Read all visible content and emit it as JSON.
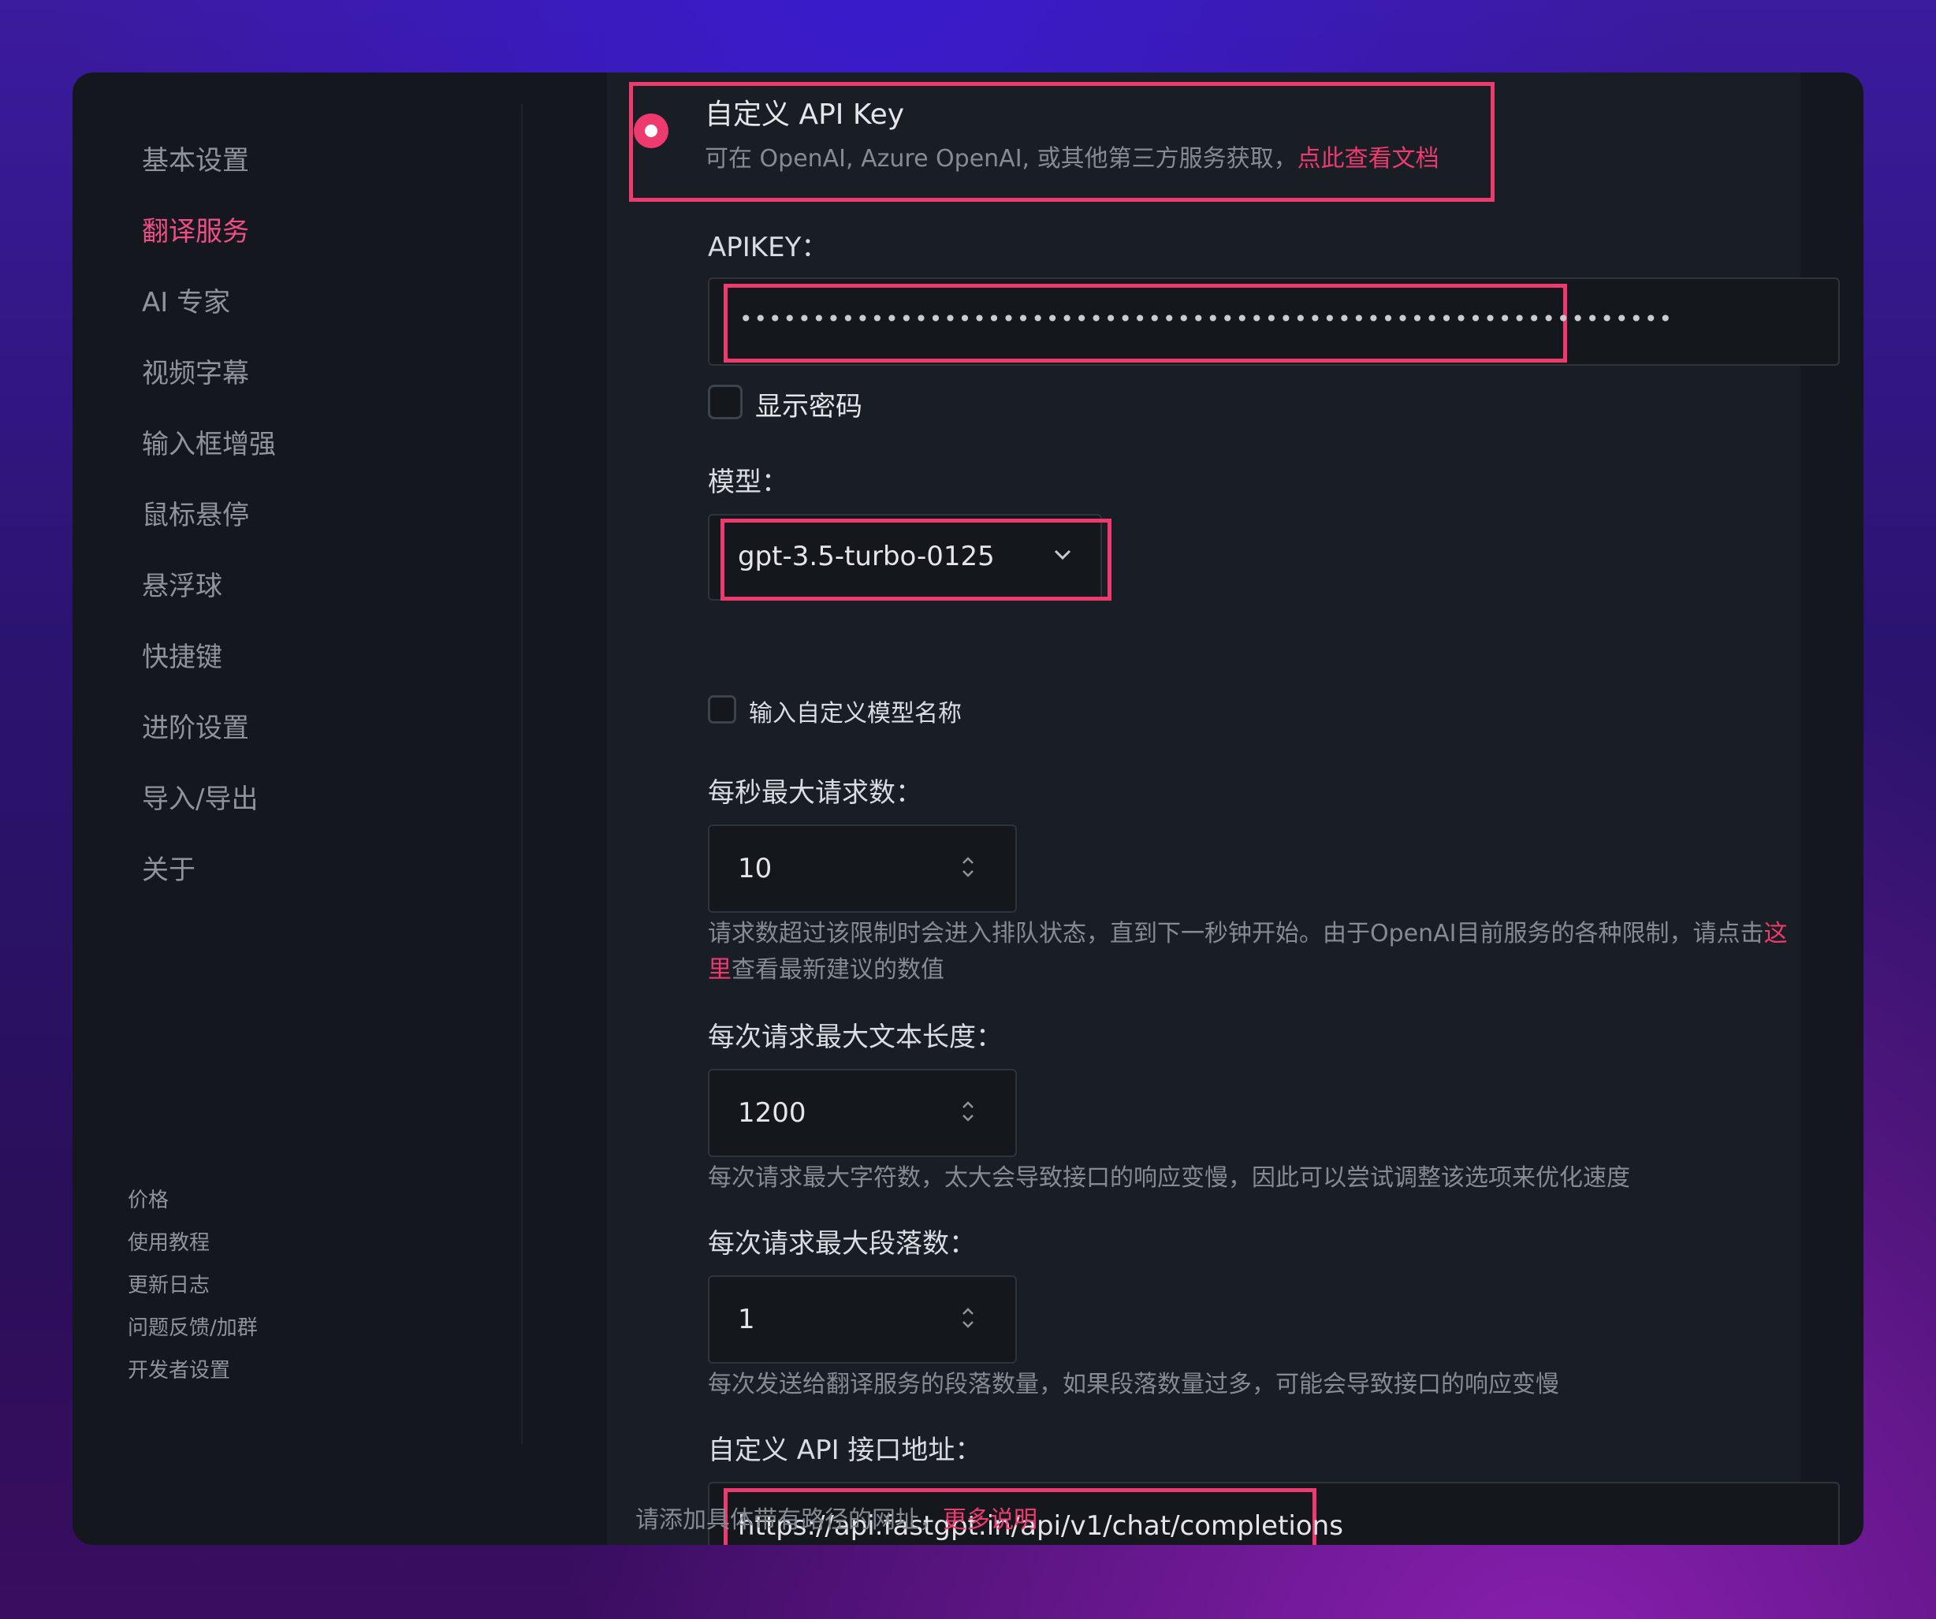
{
  "sidebar": {
    "items": [
      {
        "label": "基本设置"
      },
      {
        "label": "翻译服务"
      },
      {
        "label": "AI 专家"
      },
      {
        "label": "视频字幕"
      },
      {
        "label": "输入框增强"
      },
      {
        "label": "鼠标悬停"
      },
      {
        "label": "悬浮球"
      },
      {
        "label": "快捷键"
      },
      {
        "label": "进阶设置"
      },
      {
        "label": "导入/导出"
      },
      {
        "label": "关于"
      }
    ],
    "active": "翻译服务",
    "footer": [
      {
        "label": "价格"
      },
      {
        "label": "使用教程"
      },
      {
        "label": "更新日志"
      },
      {
        "label": "问题反馈/加群"
      },
      {
        "label": "开发者设置"
      }
    ]
  },
  "custom_key": {
    "title": "自定义 API Key",
    "desc": "可在 OpenAI, Azure OpenAI, 或其他第三方服务获取，",
    "link": "点此查看文档",
    "selected": true
  },
  "apikey": {
    "label": "APIKEY：",
    "value": "••••••••••••••••••••••••••••••••••••••••••••••••••••••••••••••••",
    "show_password_label": "显示密码"
  },
  "model": {
    "label": "模型：",
    "selected": "gpt-3.5-turbo-0125",
    "custom_name_label": "输入自定义模型名称"
  },
  "rate": {
    "label": "每秒最大请求数：",
    "value": "10",
    "desc_line1": "请求数超过该限制时会进入排队状态，直到下一秒钟开始。由于OpenAI目前服务的各种限制，请点击",
    "link1": "这",
    "link2": "里",
    "desc_line2": "查看最新建议的数值"
  },
  "max_text": {
    "label": "每次请求最大文本长度：",
    "value": "1200",
    "desc": "每次请求最大字符数，太大会导致接口的响应变慢，因此可以尝试调整该选项来优化速度"
  },
  "max_paragraphs": {
    "label": "每次请求最大段落数：",
    "value": "1",
    "desc": "每次发送给翻译服务的段落数量，如果段落数量过多，可能会导致接口的响应变慢"
  },
  "api_url": {
    "label": "自定义 API 接口地址：",
    "value": "https://api.fastgpt.in/api/v1/chat/completions",
    "desc": "请添加具体带有路径的网址，",
    "link": "更多说明"
  },
  "colors": {
    "accent": "#ee3a6e",
    "panel": "#191e24",
    "sidebar": "#14181e"
  }
}
